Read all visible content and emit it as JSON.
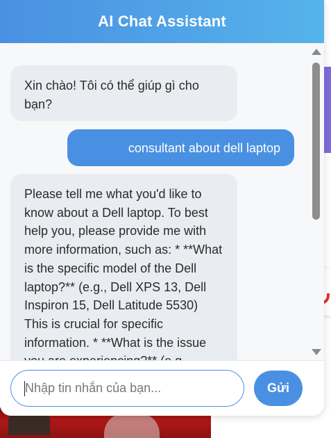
{
  "header": {
    "title": "AI Chat Assistant"
  },
  "messages": [
    {
      "role": "bot",
      "text": "Xin chào! Tôi có thể giúp gì cho bạn?"
    },
    {
      "role": "user",
      "text": "consultant about dell laptop"
    },
    {
      "role": "bot",
      "text": "Please tell me what you'd like to know about a Dell laptop. To best help you, please provide me with more information, such as: * **What is the specific model of the Dell laptop?** (e.g., Dell XPS 13, Dell Inspiron 15, Dell Latitude 5530) This is crucial for specific information. * **What is the issue you are experiencing?** (e.g."
    }
  ],
  "input": {
    "placeholder": "Nhập tin nhắn của bạn...",
    "value": ""
  },
  "send_button": {
    "label": "Gửi"
  },
  "colors": {
    "accent": "#4a90e2",
    "header_gradient_end": "#55b3ea",
    "bot_bubble": "#e9ecf0",
    "user_bubble": "#4a90e2"
  }
}
